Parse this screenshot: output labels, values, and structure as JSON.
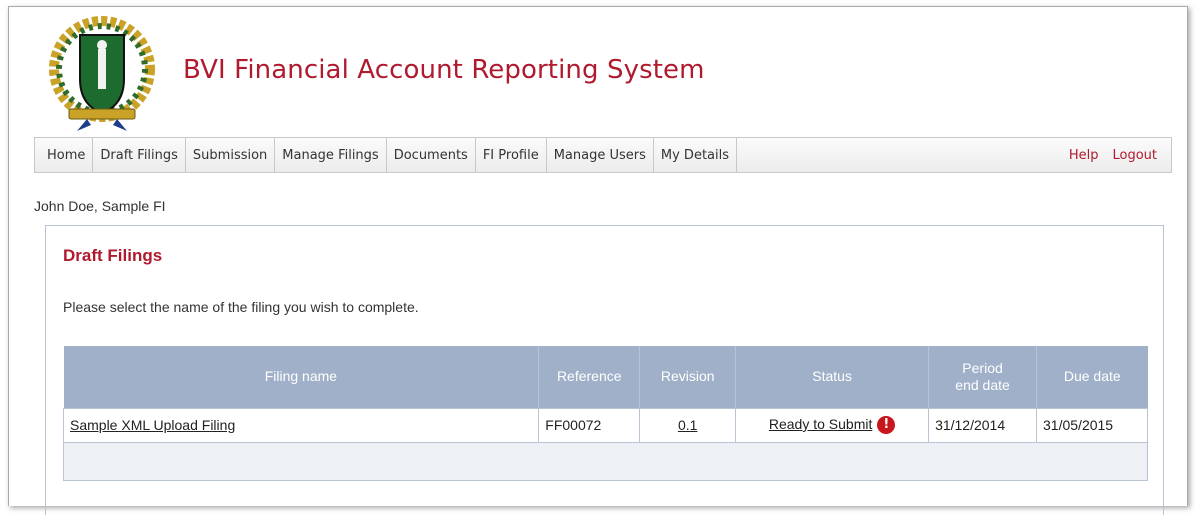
{
  "app": {
    "title": "BVI Financial Account Reporting System"
  },
  "nav": {
    "items": [
      "Home",
      "Draft Filings",
      "Submission",
      "Manage Filings",
      "Documents",
      "FI Profile",
      "Manage Users",
      "My Details"
    ],
    "help": "Help",
    "logout": "Logout"
  },
  "user": {
    "line": "John Doe, Sample FI"
  },
  "page": {
    "title": "Draft Filings",
    "instructions": "Please select the name of the filing you wish to complete."
  },
  "table": {
    "headers": {
      "filing_name": "Filing name",
      "reference": "Reference",
      "revision": "Revision",
      "status": "Status",
      "period_line1": "Period",
      "period_line2": "end date",
      "due_date": "Due date"
    },
    "rows": [
      {
        "filing_name": "Sample XML Upload Filing",
        "reference": "FF00072",
        "revision": "0.1",
        "status": "Ready to Submit",
        "status_icon": "!",
        "period_end": "31/12/2014",
        "due_date": "31/05/2015"
      }
    ]
  },
  "colors": {
    "brand_red": "#b01a2e",
    "table_header": "#9fb0c8",
    "warning_red": "#c8161d"
  },
  "icons": {
    "logo": "bvi-coat-of-arms-logo",
    "status": "exclamation-warning-icon"
  }
}
